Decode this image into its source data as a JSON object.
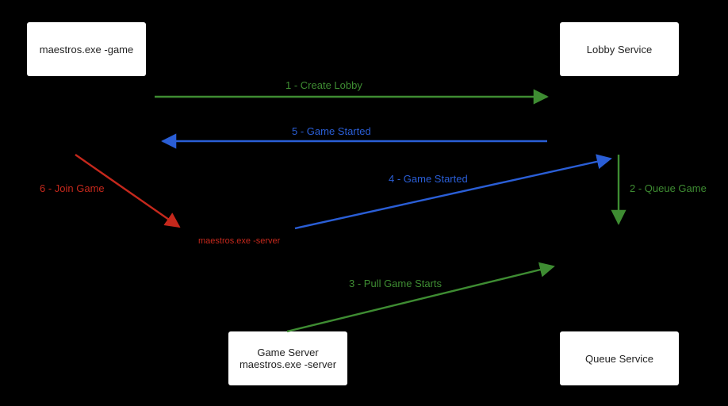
{
  "nodes": {
    "client": "maestros.exe -game",
    "lobby": "Lobby Service",
    "server_box": "Game Server\nmaestros.exe -server",
    "queue": "Queue Service"
  },
  "steps": {
    "s1": "1 - Create Lobby",
    "s2": "2 - Queue Game",
    "s3": "3 - Pull Game Starts",
    "s4": "4 - Game Started",
    "s5": "5 - Game Started",
    "s6": "6 - Join Game"
  },
  "maestros_label": "maestros.exe -server",
  "colors": {
    "green": "#3e8c32",
    "blue": "#2a5ed6",
    "red": "#c5281c",
    "node_bg": "#ffffff",
    "bg": "#000000"
  },
  "diagram_type": "sequence-flow"
}
